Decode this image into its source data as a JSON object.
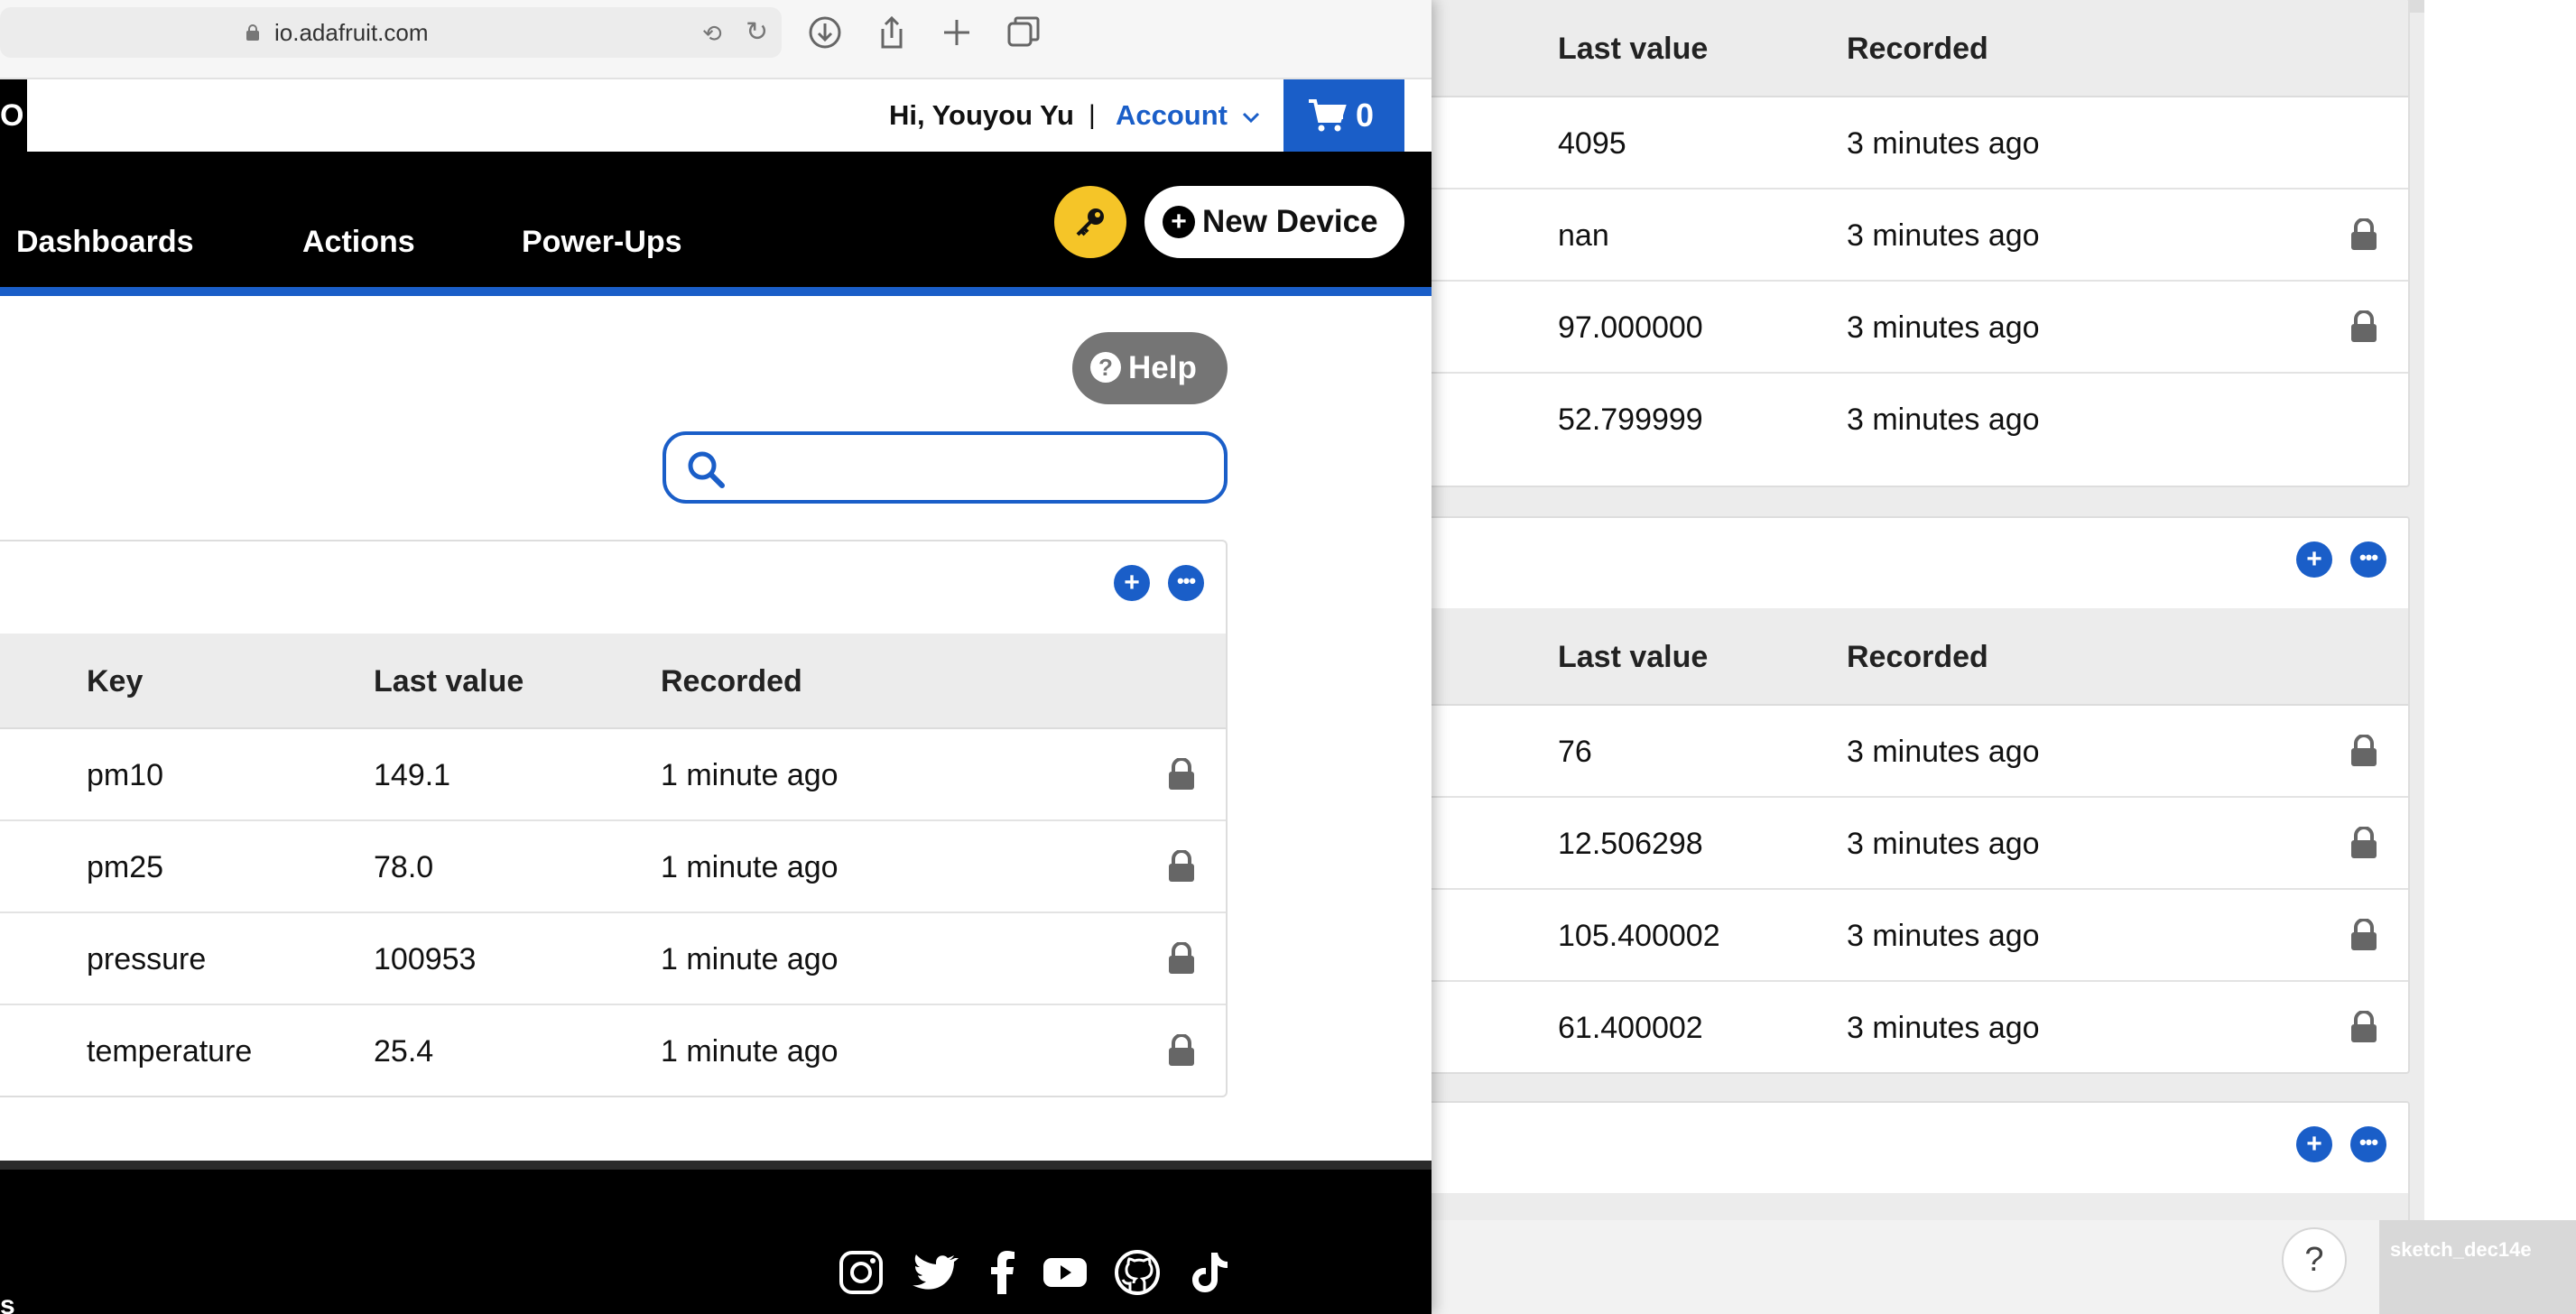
{
  "browser": {
    "url": "io.adafruit.com"
  },
  "header": {
    "logo_stub": "O",
    "greeting": "Hi, Youyou Yu",
    "separator": "|",
    "account_label": "Account",
    "cart_count": "0"
  },
  "nav": {
    "items": [
      "Dashboards",
      "Actions",
      "Power-Ups"
    ],
    "new_device_label": "New Device"
  },
  "help": {
    "label": "Help"
  },
  "search": {
    "placeholder": "",
    "value": ""
  },
  "group": {
    "columns": [
      "Key",
      "Last value",
      "Recorded"
    ],
    "rows": [
      {
        "key": "pm10",
        "value": "149.1",
        "recorded": "1 minute ago",
        "locked": true
      },
      {
        "key": "pm25",
        "value": "78.0",
        "recorded": "1 minute ago",
        "locked": true
      },
      {
        "key": "pressure",
        "value": "100953",
        "recorded": "1 minute ago",
        "locked": true
      },
      {
        "key": "temperature",
        "value": "25.4",
        "recorded": "1 minute ago",
        "locked": true
      }
    ]
  },
  "footer": {
    "stub": "s"
  },
  "background_window": {
    "group1": {
      "columns": [
        "Last value",
        "Recorded"
      ],
      "rows": [
        {
          "value": "4095",
          "recorded": "3 minutes ago",
          "locked": false
        },
        {
          "value": "nan",
          "recorded": "3 minutes ago",
          "locked": true
        },
        {
          "value": "97.000000",
          "recorded": "3 minutes ago",
          "locked": true
        },
        {
          "value": "52.799999",
          "recorded": "3 minutes ago",
          "locked": false
        }
      ]
    },
    "group2": {
      "columns": [
        "Last value",
        "Recorded"
      ],
      "rows": [
        {
          "value": "76",
          "recorded": "3 minutes ago",
          "locked": true
        },
        {
          "value": "12.506298",
          "recorded": "3 minutes ago",
          "locked": true
        },
        {
          "value": "105.400002",
          "recorded": "3 minutes ago",
          "locked": true
        },
        {
          "value": "61.400002",
          "recorded": "3 minutes ago",
          "locked": true
        }
      ]
    },
    "help_glyph": "?",
    "desktop_label": "sketch_dec14e"
  },
  "icons": {
    "social": [
      "instagram-icon",
      "twitter-icon",
      "facebook-icon",
      "youtube-icon",
      "github-icon",
      "tiktok-icon"
    ]
  },
  "colors": {
    "accent": "#1a5ec8",
    "key_button": "#f5c528",
    "nav_bg": "#000000",
    "help_button": "#757575"
  }
}
